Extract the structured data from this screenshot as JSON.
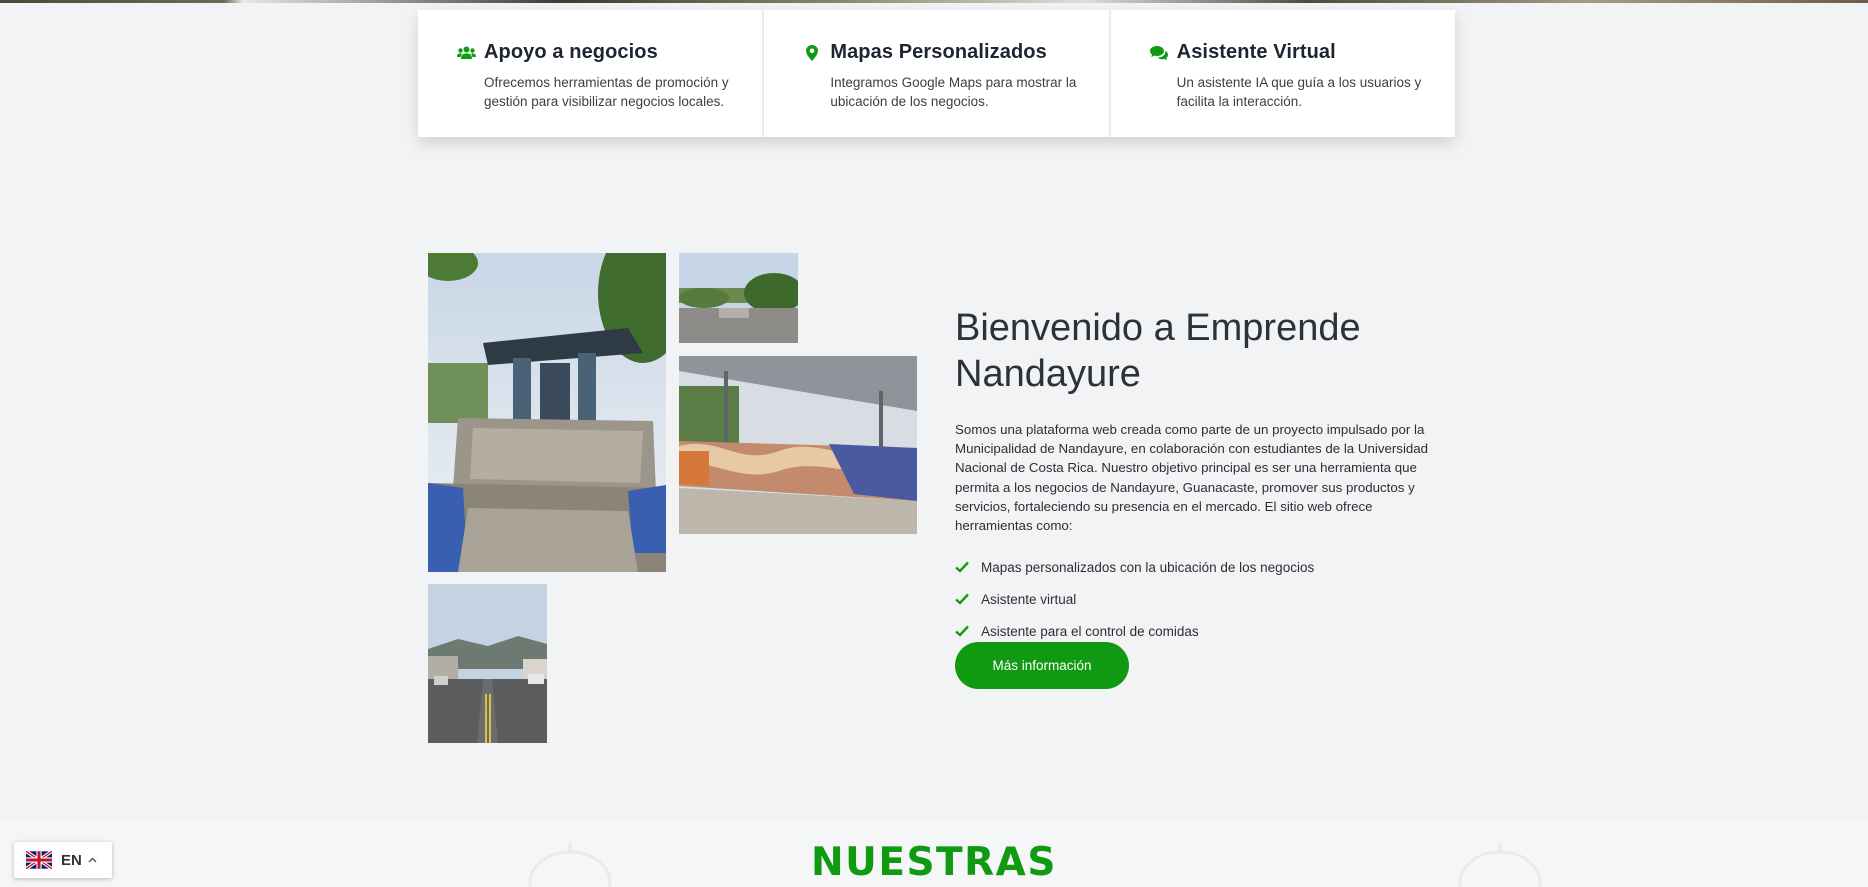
{
  "features": [
    {
      "icon": "users-icon",
      "title": "Apoyo a negocios",
      "text": "Ofrecemos herramientas de promoción y gestión para visibilizar negocios locales."
    },
    {
      "icon": "map-marker-icon",
      "title": "Mapas Personalizados",
      "text": "Integramos Google Maps para mostrar la ubicación de los negocios."
    },
    {
      "icon": "chat-icon",
      "title": "Asistente Virtual",
      "text": "Un asistente IA que guía a los usuarios y facilita la interacción."
    }
  ],
  "welcome": {
    "title": "Bienvenido a Emprende Nandayure",
    "description": "Somos una plataforma web creada como parte de un proyecto impulsado por la Municipalidad de Nandayure, en colaboración con estudiantes de la Universidad Nacional de Costa Rica. Nuestro objetivo principal es ser una herramienta que permita a los negocios de Nandayure, Guanacaste, promover sus productos y servicios, fortaleciendo su presencia en el mercado. El sitio web ofrece herramientas como:",
    "checklist": [
      "Mapas personalizados con la ubicación de los negocios",
      "Asistente virtual",
      "Asistente para el control de comidas"
    ],
    "button_label": "Más información"
  },
  "section_heading": "NUESTRAS",
  "language": {
    "code": "EN"
  },
  "colors": {
    "accent": "#0f9a11",
    "background": "#f2f3f5",
    "card": "#ffffff"
  }
}
